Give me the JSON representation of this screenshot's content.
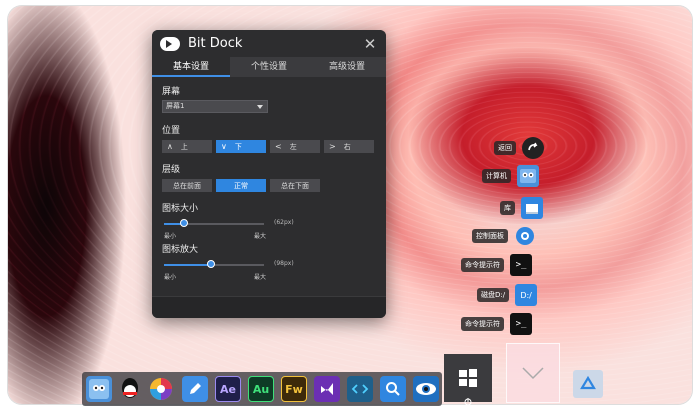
{
  "window": {
    "title": "Bit Dock",
    "close_glyph": "✕",
    "tabs": [
      {
        "label": "基本设置",
        "active": true
      },
      {
        "label": "个性设置",
        "active": false
      },
      {
        "label": "高级设置",
        "active": false
      }
    ],
    "screen": {
      "label": "屏幕",
      "selected": "屏幕1"
    },
    "position": {
      "label": "位置",
      "options": [
        {
          "arrow": "∧",
          "label": "上",
          "active": false
        },
        {
          "arrow": "∨",
          "label": "下",
          "active": true
        },
        {
          "arrow": "<",
          "label": "左",
          "active": false
        },
        {
          "arrow": ">",
          "label": "右",
          "active": false
        }
      ]
    },
    "layer": {
      "label": "层级",
      "options": [
        {
          "label": "总在前面",
          "active": false
        },
        {
          "label": "正常",
          "active": true
        },
        {
          "label": "总在下面",
          "active": false
        }
      ]
    },
    "icon_size": {
      "label": "图标大小",
      "value_text": "(62px)",
      "min": "最小",
      "max": "最大",
      "level": 0.2
    },
    "icon_zoom": {
      "label": "图标放大",
      "value_text": "(98px)",
      "min": "最小",
      "max": "最大",
      "level": 0.47
    }
  },
  "side_menu": [
    {
      "label": "返回",
      "icon": "back-arrow-icon"
    },
    {
      "label": "计算机",
      "icon": "computer-icon"
    },
    {
      "label": "库",
      "icon": "library-icon"
    },
    {
      "label": "控制面板",
      "icon": "control-panel-icon"
    },
    {
      "label": "命令提示符",
      "icon": "terminal-icon"
    },
    {
      "label": "磁盘D:/",
      "icon": "disk-icon"
    },
    {
      "label": "命令提示符",
      "icon": "terminal-icon"
    }
  ],
  "dock": {
    "icons": [
      {
        "name": "finder-icon",
        "text": "",
        "bg": "#4a90d9"
      },
      {
        "name": "qq-icon",
        "text": "",
        "bg": "transparent"
      },
      {
        "name": "color-wheel-icon",
        "text": "",
        "bg": "transparent"
      },
      {
        "name": "pen-icon",
        "text": "",
        "bg": "#3f8fe6"
      },
      {
        "name": "after-effects-icon",
        "text": "Ae",
        "bg": "#1f1f4a"
      },
      {
        "name": "audition-icon",
        "text": "Au",
        "bg": "#0e3b26"
      },
      {
        "name": "fireworks-icon",
        "text": "Fw",
        "bg": "#3d2a0a"
      },
      {
        "name": "visual-studio-icon",
        "text": "",
        "bg": "#6b2fb3"
      },
      {
        "name": "code-icon",
        "text": "",
        "bg": "#1e5f8a"
      },
      {
        "name": "search-app-icon",
        "text": "",
        "bg": "#2f86e0"
      },
      {
        "name": "eye-icon",
        "text": "",
        "bg": "#1f6fc0"
      }
    ]
  },
  "colors": {
    "accent": "#2f86e0",
    "window_bg": "#2d2d2f"
  }
}
